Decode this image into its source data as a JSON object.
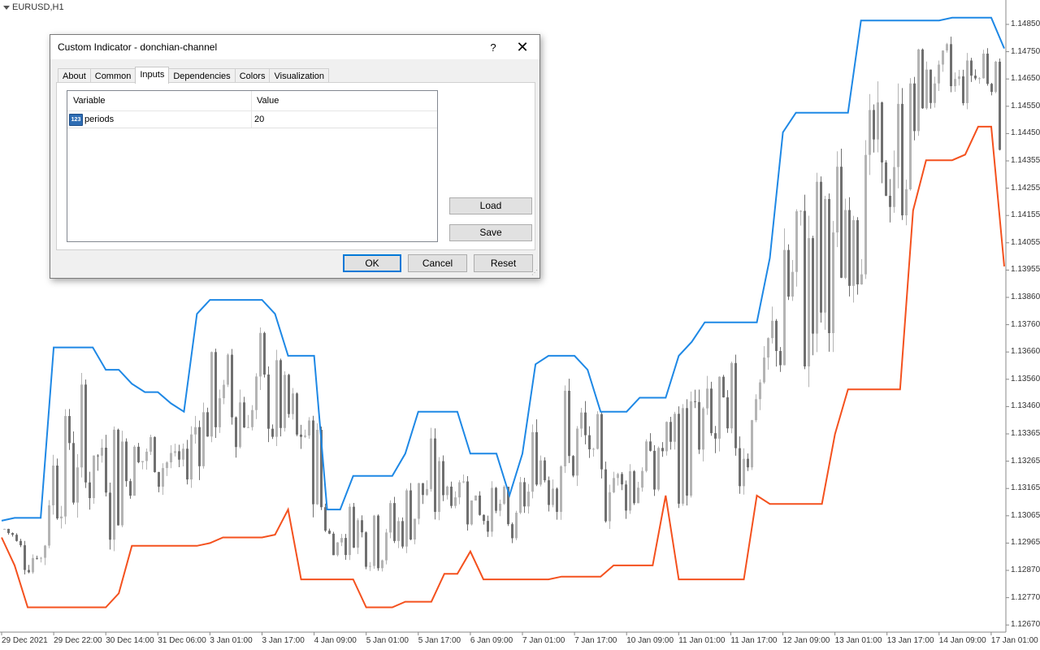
{
  "chart": {
    "symbol": "EURUSD,H1",
    "y_ticks": [
      "1.14850",
      "1.14750",
      "1.14650",
      "1.14550",
      "1.14450",
      "1.14355",
      "1.14255",
      "1.14155",
      "1.14055",
      "1.13955",
      "1.13860",
      "1.13760",
      "1.13660",
      "1.13560",
      "1.13460",
      "1.13365",
      "1.13265",
      "1.13165",
      "1.13065",
      "1.12965",
      "1.12870",
      "1.12770",
      "1.12670"
    ],
    "x_ticks": [
      "29 Dec 2021",
      "29 Dec 22:00",
      "30 Dec 14:00",
      "31 Dec 06:00",
      "3 Jan 01:00",
      "3 Jan 17:00",
      "4 Jan 09:00",
      "5 Jan 01:00",
      "5 Jan 17:00",
      "6 Jan 09:00",
      "7 Jan 01:00",
      "7 Jan 17:00",
      "10 Jan 09:00",
      "11 Jan 01:00",
      "11 Jan 17:00",
      "12 Jan 09:00",
      "13 Jan 01:00",
      "13 Jan 17:00",
      "14 Jan 09:00",
      "17 Jan 01:00"
    ],
    "colors": {
      "upper_band": "#1e88e5",
      "lower_band": "#f4511e",
      "bull_candle": "#b4b4b4",
      "bear_candle": "#707070"
    }
  },
  "chart_data": {
    "type": "line",
    "series": [
      {
        "name": "upper",
        "values": [
          1.1306,
          1.1307,
          1.1307,
          1.1307,
          1.1368,
          1.1368,
          1.1368,
          1.1368,
          1.136,
          1.136,
          1.1355,
          1.1352,
          1.1352,
          1.1348,
          1.1345,
          1.138,
          1.1385,
          1.1385,
          1.1385,
          1.1385,
          1.1385,
          1.138,
          1.1365,
          1.1365,
          1.1365,
          1.131,
          1.131,
          1.1322,
          1.1322,
          1.1322,
          1.1322,
          1.133,
          1.1345,
          1.1345,
          1.1345,
          1.1345,
          1.133,
          1.133,
          1.133,
          1.1315,
          1.133,
          1.1362,
          1.1365,
          1.1365,
          1.1365,
          1.136,
          1.1345,
          1.1345,
          1.1345,
          1.135,
          1.135,
          1.135,
          1.1365,
          1.137,
          1.1377,
          1.1377,
          1.1377,
          1.1377,
          1.1377,
          1.14,
          1.1445,
          1.1452,
          1.1452,
          1.1452,
          1.1452,
          1.1452,
          1.1485,
          1.1485,
          1.1485,
          1.1485,
          1.1485,
          1.1485,
          1.1485,
          1.1486,
          1.1486,
          1.1486,
          1.1486,
          1.1475
        ]
      },
      {
        "name": "lower",
        "values": [
          1.13,
          1.129,
          1.1275,
          1.1275,
          1.1275,
          1.1275,
          1.1275,
          1.1275,
          1.1275,
          1.128,
          1.1297,
          1.1297,
          1.1297,
          1.1297,
          1.1297,
          1.1297,
          1.1298,
          1.13,
          1.13,
          1.13,
          1.13,
          1.1301,
          1.131,
          1.1285,
          1.1285,
          1.1285,
          1.1285,
          1.1285,
          1.1275,
          1.1275,
          1.1275,
          1.1277,
          1.1277,
          1.1277,
          1.1287,
          1.1287,
          1.1295,
          1.1285,
          1.1285,
          1.1285,
          1.1285,
          1.1285,
          1.1285,
          1.1286,
          1.1286,
          1.1286,
          1.1286,
          1.129,
          1.129,
          1.129,
          1.129,
          1.1315,
          1.1285,
          1.1285,
          1.1285,
          1.1285,
          1.1285,
          1.1285,
          1.1315,
          1.1312,
          1.1312,
          1.1312,
          1.1312,
          1.1312,
          1.1337,
          1.1353,
          1.1353,
          1.1353,
          1.1353,
          1.1353,
          1.1417,
          1.1435,
          1.1435,
          1.1435,
          1.1437,
          1.1447,
          1.1447,
          1.1397
        ]
      }
    ],
    "ylim": [
      1.1267,
      1.149
    ]
  },
  "dialog": {
    "title": "Custom Indicator - donchian-channel",
    "help_label": "?",
    "close_label": "✕",
    "tabs": [
      "About",
      "Common",
      "Inputs",
      "Dependencies",
      "Colors",
      "Visualization"
    ],
    "active_tab": "Inputs",
    "grid": {
      "headers": [
        "Variable",
        "Value"
      ],
      "rows": [
        {
          "icon": "123",
          "name": "periods",
          "value": "20"
        }
      ]
    },
    "load_label": "Load",
    "save_label": "Save",
    "ok_label": "OK",
    "cancel_label": "Cancel",
    "reset_label": "Reset"
  }
}
